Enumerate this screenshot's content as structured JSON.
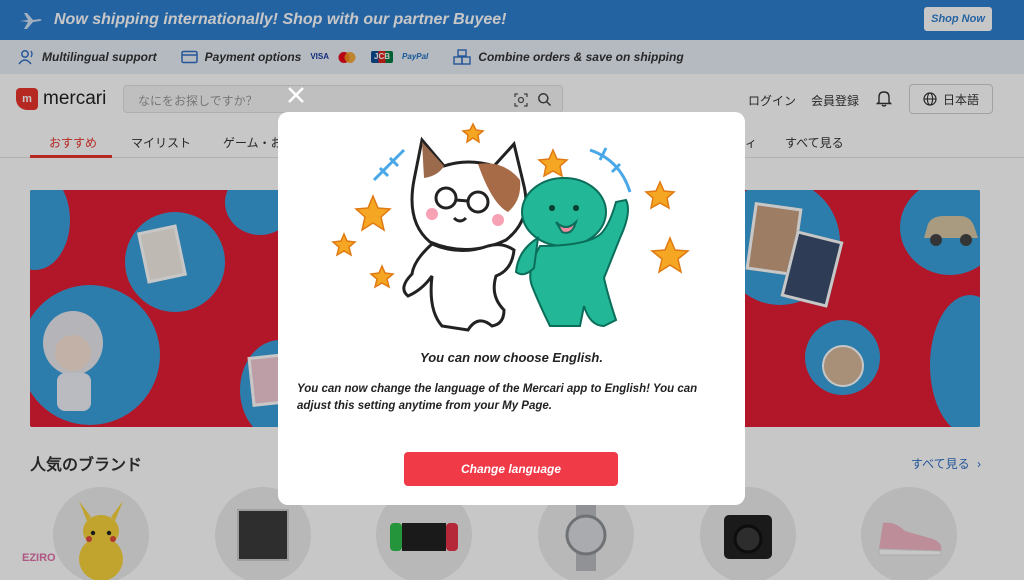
{
  "promo": {
    "text": "Now shipping internationally! Shop with our partner Buyee!",
    "button": "Shop Now"
  },
  "info_bar": {
    "items": [
      {
        "label": "Multilingual support",
        "icon": "person-voice-icon"
      },
      {
        "label": "Payment options",
        "icon": "card-icon"
      },
      {
        "label": "Combine orders & save on shipping",
        "icon": "boxes-icon"
      }
    ],
    "payment_logos": [
      "VISA",
      "mastercard",
      "JCB",
      "PayPal"
    ]
  },
  "header": {
    "logo": "mercari",
    "logo_mark": "m",
    "search_placeholder": "なにをお探しですか？",
    "login": "ログイン",
    "signup": "会員登録",
    "language": "日本語"
  },
  "tabs": {
    "items": [
      "おすすめ",
      "マイリスト",
      "ゲーム・お",
      "ィ",
      "すべて見る"
    ],
    "active": 0
  },
  "brands": {
    "title": "人気のブランド",
    "see_all": "すべて見る",
    "items": [
      "pikachu",
      "kpop-album",
      "game-console",
      "watch",
      "camera",
      "sneaker"
    ]
  },
  "watermark": "EZIRO",
  "modal": {
    "title": "You can now choose English.",
    "body": "You can now change the language of the Mercari app to English! You can adjust this setting anytime from your My Page.",
    "button": "Change language"
  },
  "colors": {
    "brand_red": "#ea352d",
    "promo_blue": "#2f7fd0",
    "cta_red": "#f03a48",
    "hero_red": "#e31e35",
    "hero_blue": "#39a1dd"
  }
}
